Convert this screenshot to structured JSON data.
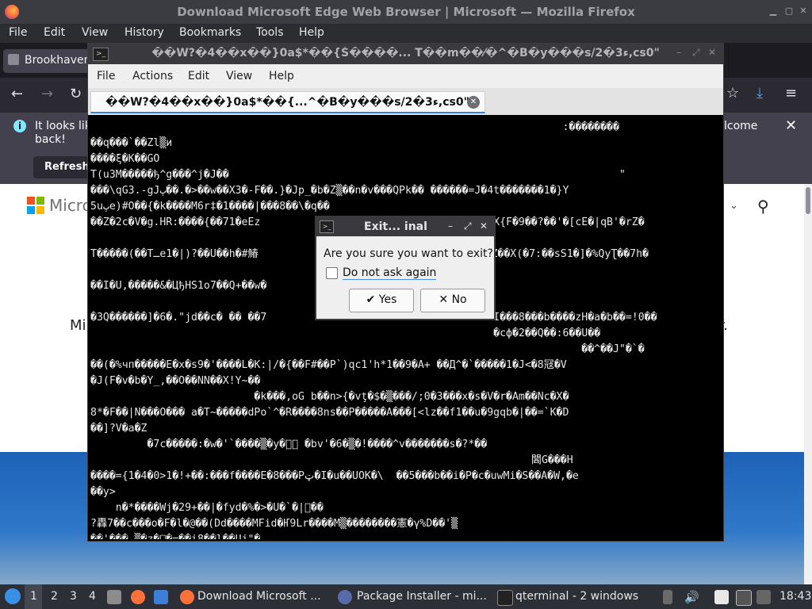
{
  "firefox": {
    "window_title": "Download Microsoft Edge Web Browser | Microsoft — Mozilla Firefox",
    "menu": [
      "File",
      "Edit",
      "View",
      "History",
      "Bookmarks",
      "Tools",
      "Help"
    ],
    "tab_label": "Brookhaven",
    "notification": {
      "text_line1": "It looks lik",
      "text_line2": "back!",
      "right_text": "lcome",
      "refresh_label": "Refresh"
    },
    "page": {
      "logo_text": "Micro",
      "left_text": "Mi",
      "right_text": "y."
    }
  },
  "qterminal": {
    "window_title": "��W?�4��x��}0a$*��{Š����... T��m��⁄�^�B�y���s/2�3ء,cs0\"",
    "menu": [
      "File",
      "Actions",
      "Edit",
      "View",
      "Help"
    ],
    "tab_title": "��W?�4��x��}0a$*��{...^�B�y���s/2�3ء,cs0\"",
    "screen_lines": [
      "                                                                           :��������",
      "��q���`��Zl▒и",
      "����ξ�K��GO",
      "T(u3M�����ђ^g���^j�J��                                                              \"",
      "���\\qGЗ.-gJپ��.�>��w��X3�-F��.}�Jp_�b�Z▒��n�v���QPk�� ������=J�4t�������1�}Y",
      "5uپe)#O��{�k����M6r‡�1����|���8��\\�q��",
      "��Z�2c�V�g.HR:����{��71�eEz                                    �X{F�9��?��'�[cE�|qB'�rZ�",
      "",
      "T�����(��Tـe1�|)?��U��h�#鰆                                    �Z��X(�7:��sS1�]�%QyƮ��7h�",
      "",
      "��I�U,�����&�ЦђHS1o7��Q+��w�                                    ",
      "",
      "�3Q������]�6�.\"jd��c� �� ��7                                    I���8���b����zH�a�b��=!0��",
      "                                                                �сф�2��Q��:6��U��",
      "                                                                              ��^��J\"�`�",
      "��(�%чп�����E�x�s9�'����L�K:|/�{��F#��P`)qc1'h*1��9�A+ ��Д^�`�����1�J<�8冦�V",
      "�J(F�v�b�Y_,��O��NN��X!Y~��",
      "                          �k���,oG b��n>{�vţ�$�▒���/;0�3���x�s�V�r�Am��Nc�X�",
      "8*�F��|N���O��� a�T~�����dPo`^�R����8ns��P�����A���[<lz��f1��u�9gqb�|��=`K�D",
      "��]?V�a�Z",
      "         �7c�����:�w�'`����▒�y�⃞⃞ �bv'�6�▒�!����^v�������s�?*��",
      "                                                                      閪G���H",
      "����={1�4�0>1�!+��:���f����E�8���Pټ�I�u��UOK�\\  ��5���b��i�P�c�uwMi�S��A�W,�e",
      "��y>",
      "    n�*����Wj�29+��|�fyd�%�>�U�`�|⃞��",
      "?轟7��c���o�F�l�@��(Dd����MFid�Ҥ9Lr����M▒��������憲�γ%D��'▒",
      "��'��� ▒�z�⃞�=��i8��l��Uj\"�"
    ]
  },
  "dialog": {
    "title": "Exit...  inal",
    "message": "Are you sure you want to exit?",
    "checkbox_label": "Do not ask again",
    "yes_label": "Yes",
    "no_label": "No"
  },
  "taskbar": {
    "workspaces": [
      "1",
      "2",
      "3",
      "4"
    ],
    "tasks": [
      "Download Microsoft ...",
      "Package Installer - mi...",
      "qterminal - 2 windows"
    ],
    "clock": "18:43"
  }
}
